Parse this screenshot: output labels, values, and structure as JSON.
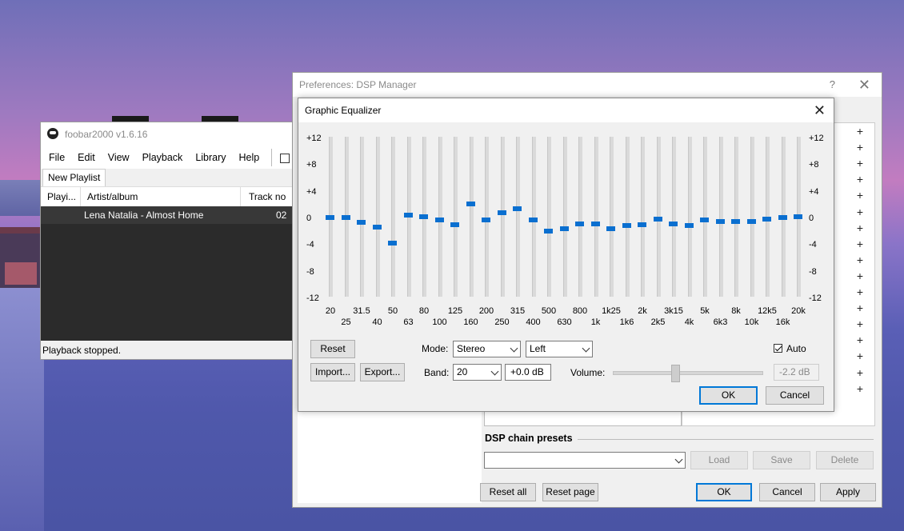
{
  "foobar": {
    "title": "foobar2000 v1.6.16",
    "menu": [
      "File",
      "Edit",
      "View",
      "Playback",
      "Library",
      "Help"
    ],
    "tab": "New Playlist",
    "columns": [
      "Playi...",
      "Artist/album",
      "Track no"
    ],
    "rows": [
      {
        "playing": "",
        "artist_album": "Lena Natalia - Almost Home",
        "track": "02"
      }
    ],
    "status": "Playback stopped."
  },
  "dsp": {
    "title": "Preferences: DSP Manager",
    "help_glyph": "?",
    "close_glyph": "✕",
    "presets_label": "DSP chain presets",
    "preset_value": "",
    "load_label": "Load",
    "save_label": "Save",
    "delete_label": "Delete",
    "reset_all_label": "Reset all",
    "reset_page_label": "Reset page",
    "ok_label": "OK",
    "cancel_label": "Cancel",
    "apply_label": "Apply",
    "plus_glyph": "+"
  },
  "eq": {
    "title": "Graphic Equalizer",
    "close_glyph": "✕",
    "db_scale": [
      "+12",
      "+8",
      "+4",
      "0",
      "-4",
      "-8",
      "-12"
    ],
    "bands_top": [
      "20",
      "31.5",
      "50",
      "80",
      "125",
      "200",
      "315",
      "500",
      "800",
      "1k25",
      "2k",
      "3k15",
      "5k",
      "8k",
      "12k5",
      "20k"
    ],
    "bands_bottom": [
      "25",
      "40",
      "63",
      "100",
      "160",
      "250",
      "400",
      "630",
      "1k",
      "1k6",
      "2k5",
      "4k",
      "6k3",
      "10k",
      "16k"
    ],
    "band_gains_db": [
      0,
      0,
      -0.7,
      -1.4,
      -3.8,
      0.4,
      0.1,
      -0.4,
      -1.1,
      2.1,
      -0.4,
      0.7,
      1.3,
      -0.4,
      -2.0,
      -1.7,
      -0.9,
      -1.0,
      -1.7,
      -1.2,
      -1.1,
      -0.2,
      -1.0,
      -1.2,
      -0.4,
      -0.6,
      -0.6,
      -0.6,
      -0.2,
      0,
      0.1
    ],
    "reset_label": "Reset",
    "import_label": "Import...",
    "export_label": "Export...",
    "mode_label": "Mode:",
    "mode_value": "Stereo",
    "channel_value": "Left",
    "band_label": "Band:",
    "band_value": "20",
    "band_gain": "+0.0 dB",
    "volume_label": "Volume:",
    "volume_level_fraction": 0.42,
    "volume_value": "-2.2 dB",
    "auto_label": "Auto",
    "auto_checked": true,
    "ok_label": "OK",
    "cancel_label": "Cancel"
  }
}
